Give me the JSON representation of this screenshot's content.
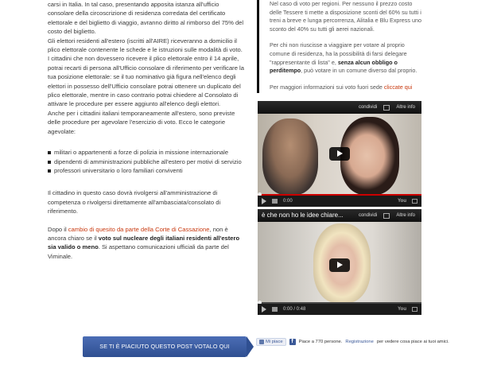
{
  "left": {
    "p1": "carsi in Italia. In tal caso, presentando apposita istanza all'ufficio consolare della circoscrizione di residenza corredata del certificato elettorale e del biglietto di viaggio, avranno diritto al rimborso del 75% del costo del biglietto.",
    "p2": "Gli elettori residenti all'estero (iscritti all'AIRE) riceveranno a domicilio il plico elettorale contenente le schede e le istruzioni sulle modalità di voto.",
    "p3": "I cittadini che non dovessero ricevere il plico elettorale entro il 14 aprile, potrai recarti di persona all'Ufficio consolare di riferimento per verificare la tua posizione elettorale: se il tuo nominativo già figura nell'elenco degli elettori in possesso dell'Ufficio consolare potrai ottenere un duplicato del plico elettorale, mentre in caso contrario potrai chiedere al Consolato di attivare le procedure per essere aggiunto all'elenco degli elettori.",
    "p4": "Anche per i cittadini italiani temporaneamente all'estero, sono previste delle procedure per agevolare l'esercizio di voto. Ecco le categorie agevolate:",
    "bullets": [
      "militari o appartenenti a forze di polizia in missione internazionale",
      "dipendenti di amministrazioni pubbliche all'estero per motivi di servizio",
      "professori universitario o loro familiari conviventi"
    ],
    "p5": "Il cittadino in questo caso dovrà rivolgersi all'amministrazione di competenza o rivolgersi direttamente all'ambasciata/consolato di riferimento.",
    "p6_pre": "Dopo il ",
    "p6_link": "cambio di quesito da parte della Corte di Cassazione",
    "p6_mid": ", non è ancora chiaro se il ",
    "p6_bold": "voto sul nucleare degli italiani residenti all'estero sia valido o meno",
    "p6_post": ". Si aspettano comunicazioni ufficiali da parte del Viminale."
  },
  "right": {
    "p1": "Nel caso di voto per regioni. Per nessuno il prezzo costo delle Tessere ti mette a disposizione sconti del 60% su tutti i treni a breve e lunga percorrenza, Alitalia e Blu Express uno sconto del 40% su tutti gli aerei nazionali.",
    "p2_pre": "Per chi non riuscisse a viaggiare per votare al proprio comune di residenza, ha la possibilità di farsi delegare \"rappresentante di lista\" e, ",
    "p2_bold": "senza alcun obbligo o perditempo",
    "p2_post": ", può votare in un comune diverso dal proprio.",
    "p3_pre": "Per maggiori informazioni sui voto fuori sede ",
    "p3_link": "cliccate qui"
  },
  "video1": {
    "share": "condividi",
    "more": "Altre info",
    "time": "0:00"
  },
  "video2": {
    "title": "è che non ho le idee chiare...",
    "share": "condividi",
    "more": "Altre info",
    "time": "0:00 / 0:48"
  },
  "vote_button": "SE TI È PIACIUTO QUESTO POST VOTALO QUI",
  "facebook": {
    "like": "Mi piace",
    "count_text": "Piace a 770 persone.",
    "register": "Registrazione",
    "after": "per vedere cosa piace ai tuoi amici."
  },
  "colors": {
    "link": "#c8390f",
    "button": "#3b5998",
    "video_progress": "#cc0000"
  }
}
